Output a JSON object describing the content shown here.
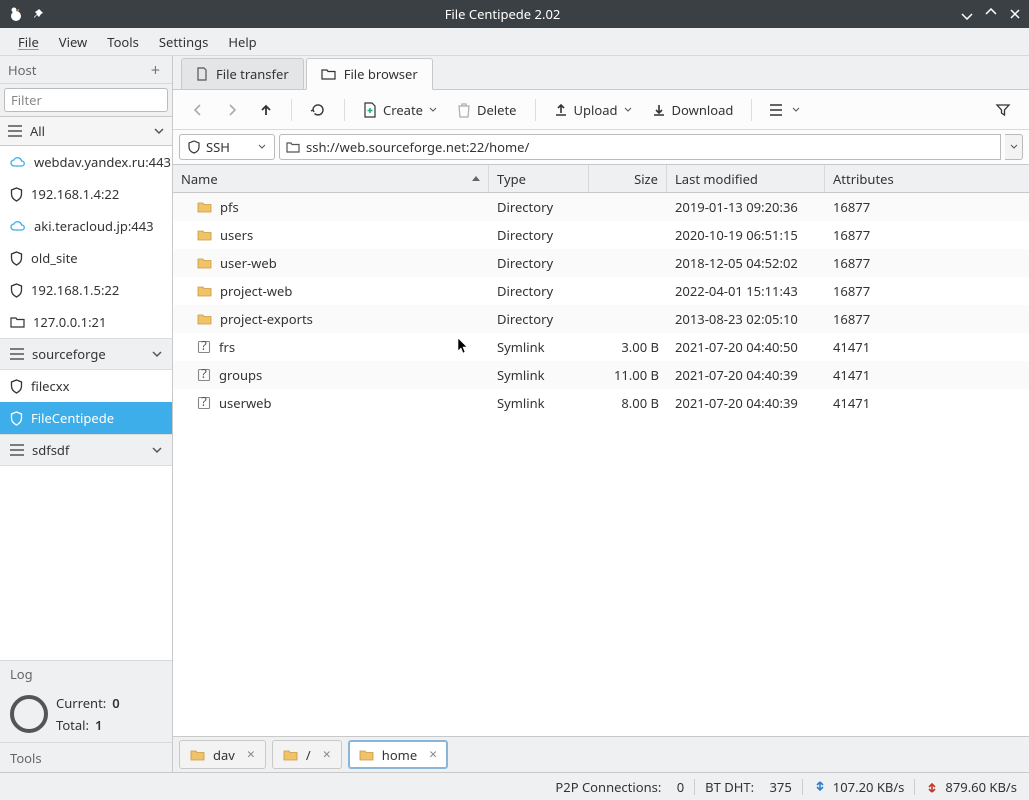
{
  "window": {
    "title": "File Centipede 2.02"
  },
  "menu": {
    "file": "File",
    "view": "View",
    "tools": "Tools",
    "settings": "Settings",
    "help": "Help"
  },
  "sidebar": {
    "host_label": "Host",
    "filter_placeholder": "Filter",
    "all_label": "All",
    "items": [
      {
        "icon": "cloud",
        "label": "webdav.yandex.ru:443"
      },
      {
        "icon": "shield",
        "label": "192.168.1.4:22"
      },
      {
        "icon": "cloud",
        "label": "aki.teracloud.jp:443"
      },
      {
        "icon": "shield",
        "label": "old_site"
      },
      {
        "icon": "shield",
        "label": "192.168.1.5:22"
      },
      {
        "icon": "folder",
        "label": "127.0.0.1:21"
      },
      {
        "icon": "burger",
        "label": "sourceforge",
        "group": true,
        "chev": true
      },
      {
        "icon": "shield",
        "label": "filecxx"
      },
      {
        "icon": "shield",
        "label": "FileCentipede",
        "selected": true
      },
      {
        "icon": "burger",
        "label": "sdfsdf",
        "group": true,
        "chev": true
      }
    ],
    "log_label": "Log",
    "current_label": "Current:",
    "current_value": "0",
    "total_label": "Total:",
    "total_value": "1",
    "tools_label": "Tools"
  },
  "tabs_top": [
    {
      "icon": "doc",
      "label": "File transfer",
      "active": false
    },
    {
      "icon": "folder",
      "label": "File browser",
      "active": true
    }
  ],
  "toolbar": {
    "create": "Create",
    "delete": "Delete",
    "upload": "Upload",
    "download": "Download"
  },
  "loc": {
    "proto": "SSH",
    "path": "ssh://web.sourceforge.net:22/home/"
  },
  "columns": {
    "name": "Name",
    "type": "Type",
    "size": "Size",
    "modified": "Last modified",
    "attributes": "Attributes"
  },
  "rows": [
    {
      "icon": "folder",
      "name": "pfs",
      "type": "Directory",
      "size": "",
      "modified": "2019-01-13 09:20:36",
      "attr": "16877"
    },
    {
      "icon": "folder",
      "name": "users",
      "type": "Directory",
      "size": "",
      "modified": "2020-10-19 06:51:15",
      "attr": "16877"
    },
    {
      "icon": "folder",
      "name": "user-web",
      "type": "Directory",
      "size": "",
      "modified": "2018-12-05 04:52:02",
      "attr": "16877"
    },
    {
      "icon": "folder",
      "name": "project-web",
      "type": "Directory",
      "size": "",
      "modified": "2022-04-01 15:11:43",
      "attr": "16877"
    },
    {
      "icon": "folder",
      "name": "project-exports",
      "type": "Directory",
      "size": "",
      "modified": "2013-08-23 02:05:10",
      "attr": "16877"
    },
    {
      "icon": "symlink",
      "name": "frs",
      "type": "Symlink",
      "size": "3.00 B",
      "modified": "2021-07-20 04:40:50",
      "attr": "41471"
    },
    {
      "icon": "symlink",
      "name": "groups",
      "type": "Symlink",
      "size": "11.00 B",
      "modified": "2021-07-20 04:40:39",
      "attr": "41471"
    },
    {
      "icon": "symlink",
      "name": "userweb",
      "type": "Symlink",
      "size": "8.00 B",
      "modified": "2021-07-20 04:40:39",
      "attr": "41471"
    }
  ],
  "tabs_bottom": [
    {
      "label": "dav",
      "active": false
    },
    {
      "label": "/",
      "active": false
    },
    {
      "label": "home",
      "active": true
    }
  ],
  "status": {
    "p2p_label": "P2P Connections:",
    "p2p_value": "0",
    "bt_label": "BT DHT:",
    "bt_value": "375",
    "down_speed": "107.20 KB/s",
    "up_speed": "879.60 KB/s"
  }
}
